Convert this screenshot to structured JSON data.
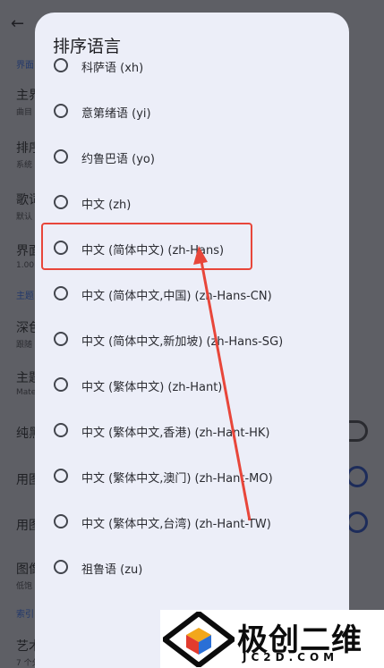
{
  "background": {
    "back_icon": "←",
    "section1": "界面",
    "items": [
      {
        "title": "主界",
        "sub": "曲目"
      },
      {
        "title": "排序",
        "sub": "系统"
      },
      {
        "title": "歌词",
        "sub": "默认"
      },
      {
        "title": "界面",
        "sub": "1.00"
      }
    ],
    "section2": "主题",
    "items2": [
      {
        "title": "深色",
        "sub": "跟随"
      },
      {
        "title": "主题",
        "sub": "Mate"
      },
      {
        "title": "纯黑",
        "sub": ""
      },
      {
        "title": "用图",
        "sub": ""
      },
      {
        "title": "用图",
        "sub": ""
      },
      {
        "title": "图像",
        "sub": "低饱"
      }
    ],
    "section3": "索引",
    "last_item": {
      "title": "艺术",
      "sub": "7 个分隔符"
    }
  },
  "dialog": {
    "title": "排序语言",
    "options": [
      {
        "label": "科萨语 (xh)"
      },
      {
        "label": "意第绪语 (yi)"
      },
      {
        "label": "约鲁巴语 (yo)"
      },
      {
        "label": "中文 (zh)"
      },
      {
        "label": "中文 (简体中文) (zh-Hans)"
      },
      {
        "label": "中文 (简体中文,中国) (zh-Hans-CN)"
      },
      {
        "label": "中文 (简体中文,新加坡) (zh-Hans-SG)"
      },
      {
        "label": "中文 (繁体中文) (zh-Hant)"
      },
      {
        "label": "中文 (繁体中文,香港) (zh-Hant-HK)"
      },
      {
        "label": "中文 (繁体中文,澳门) (zh-Hant-MO)"
      },
      {
        "label": "中文 (繁体中文,台湾) (zh-Hant-TW)"
      },
      {
        "label": "祖鲁语 (zu)"
      }
    ]
  },
  "annotation_color": "#e8463a",
  "watermark": {
    "text": "极创二维",
    "url": "JC2D.COM"
  }
}
